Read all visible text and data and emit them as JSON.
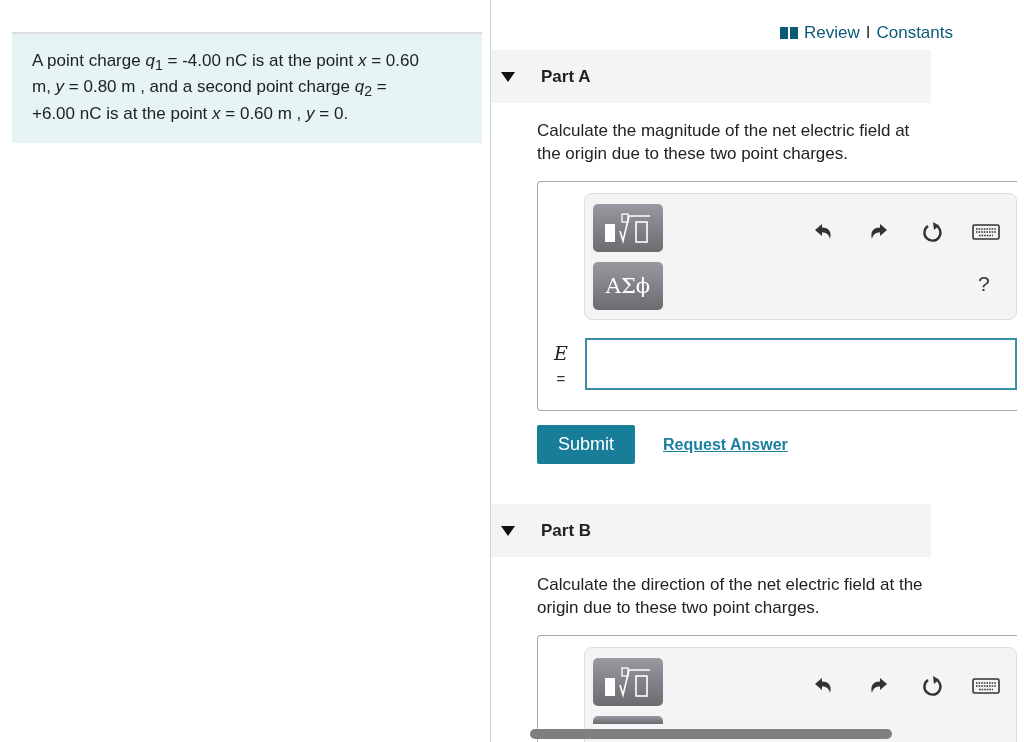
{
  "problem": {
    "text": "A point charge *q*$_{1}$ = -4.00 nC is at the point *x* = 0.60 m, *y* = 0.80 m , and a second point charge *q*$_{2}$ = +6.00 nC is at the point *x* = 0.60 m , *y* = 0."
  },
  "header_links": [
    {
      "label": "Review"
    },
    {
      "label": "Constants"
    }
  ],
  "header_separator": "I",
  "parts": [
    {
      "label": "Part A",
      "expanded": true,
      "prompt": "Calculate the magnitude of the net electric field at the origin due to these two point charges.",
      "answer": {
        "symbols_label": "ΑΣϕ",
        "help": "?",
        "variable": "E",
        "equals": "="
      },
      "submit": "Submit",
      "request": "Request Answer"
    },
    {
      "label": "Part B",
      "expanded": true,
      "prompt": "Calculate the direction of the net electric field at the origin due to these two point charges."
    }
  ]
}
